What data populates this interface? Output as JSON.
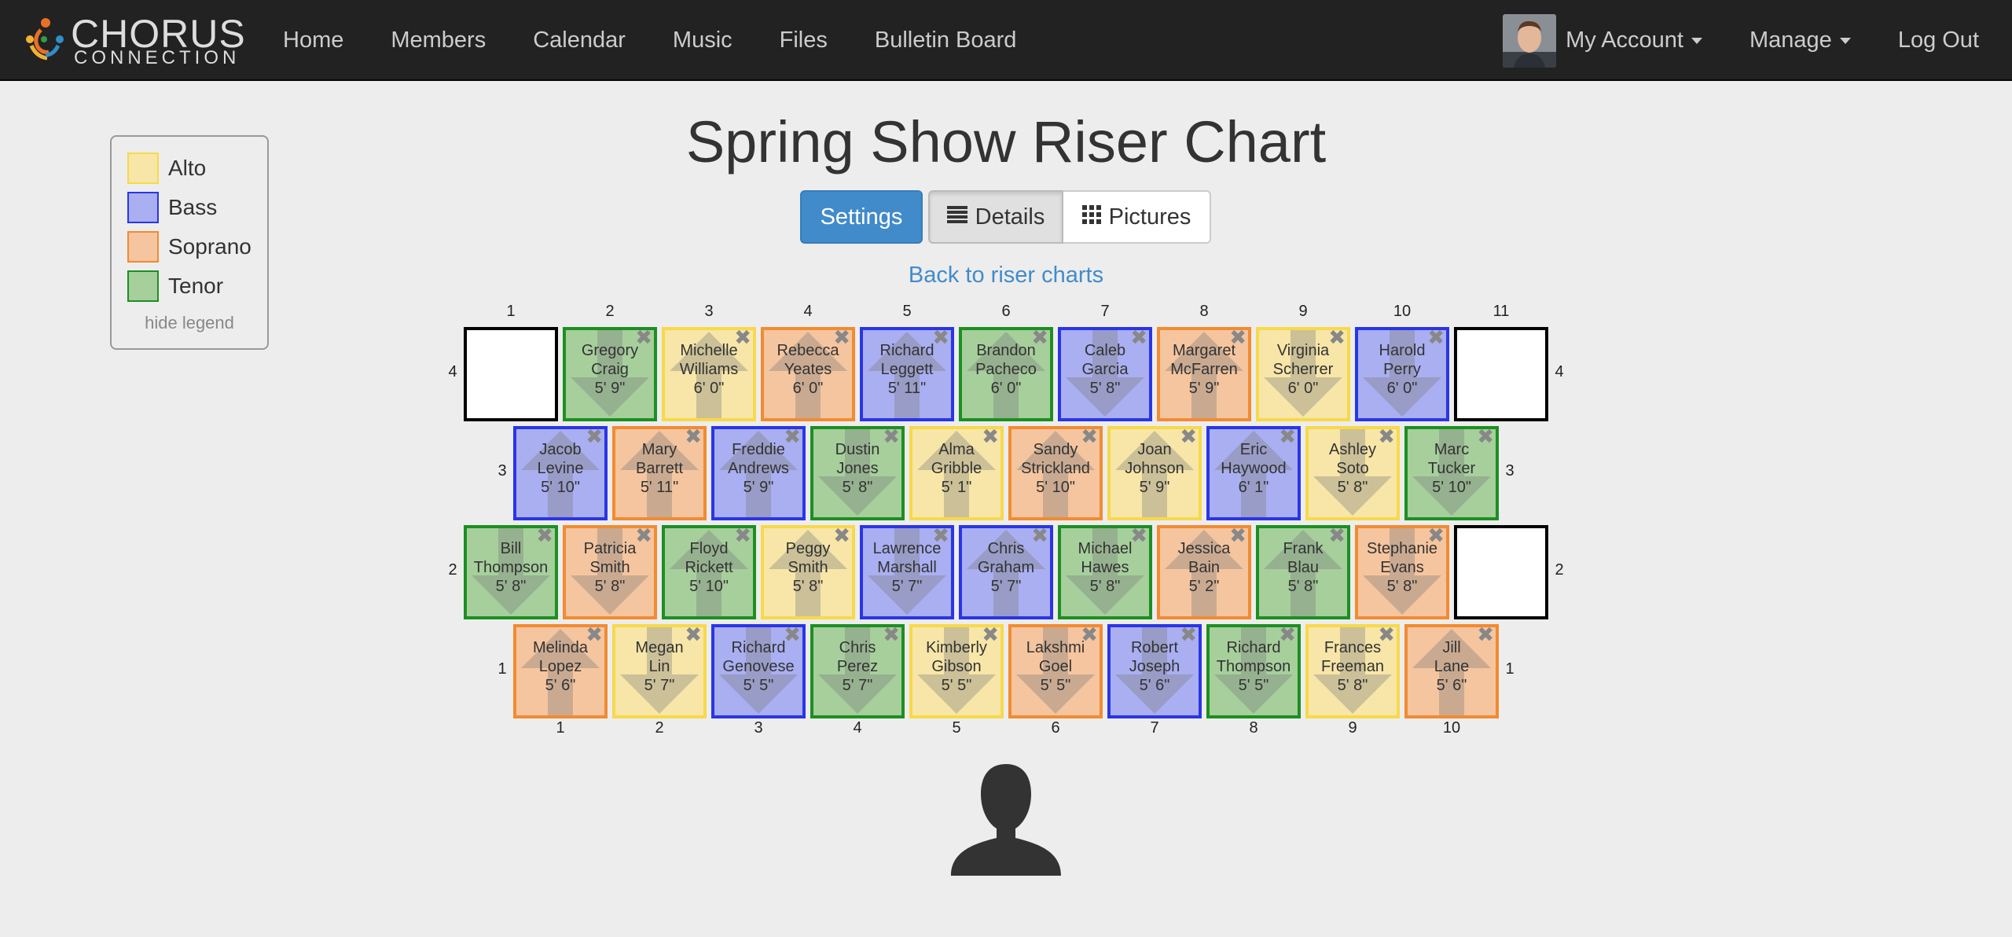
{
  "nav": {
    "brand_top": "CHORUS",
    "brand_bottom": "CONNECTION",
    "links": [
      "Home",
      "Members",
      "Calendar",
      "Music",
      "Files",
      "Bulletin Board"
    ],
    "account": "My Account",
    "manage": "Manage",
    "logout": "Log Out"
  },
  "legend": {
    "items": [
      {
        "label": "Alto",
        "color": "#f7e6a8",
        "border": "#f7d94a"
      },
      {
        "label": "Bass",
        "color": "#a9aff0",
        "border": "#2a35e6"
      },
      {
        "label": "Soprano",
        "color": "#f5c59f",
        "border": "#f28b31"
      },
      {
        "label": "Tenor",
        "color": "#a6cf9c",
        "border": "#1d8f22"
      }
    ],
    "hide": "hide legend"
  },
  "title": "Spring Show Riser Chart",
  "buttons": {
    "settings": "Settings",
    "details": "Details",
    "pictures": "Pictures"
  },
  "back_link": "Back to riser charts",
  "riser": {
    "top_positions": [
      "1",
      "2",
      "3",
      "4",
      "5",
      "6",
      "7",
      "8",
      "9",
      "10",
      "11"
    ],
    "bottom_positions": [
      "1",
      "2",
      "3",
      "4",
      "5",
      "6",
      "7",
      "8",
      "9",
      "10"
    ],
    "rows": [
      {
        "row": "4",
        "wide": true,
        "cells": [
          {
            "part": "empty"
          },
          {
            "part": "tenor",
            "first": "Gregory",
            "last": "Craig",
            "height": "5' 9\"",
            "dir": "down"
          },
          {
            "part": "alto",
            "first": "Michelle",
            "last": "Williams",
            "height": "6' 0\"",
            "dir": "up"
          },
          {
            "part": "soprano",
            "first": "Rebecca",
            "last": "Yeates",
            "height": "6' 0\"",
            "dir": "up"
          },
          {
            "part": "bass",
            "first": "Richard",
            "last": "Leggett",
            "height": "5' 11\"",
            "dir": "up"
          },
          {
            "part": "tenor",
            "first": "Brandon",
            "last": "Pacheco",
            "height": "6' 0\"",
            "dir": "up"
          },
          {
            "part": "bass",
            "first": "Caleb",
            "last": "Garcia",
            "height": "5' 8\"",
            "dir": "down"
          },
          {
            "part": "soprano",
            "first": "Margaret",
            "last": "McFarren",
            "height": "5' 9\"",
            "dir": "up"
          },
          {
            "part": "alto",
            "first": "Virginia",
            "last": "Scherrer",
            "height": "6' 0\"",
            "dir": "down"
          },
          {
            "part": "bass",
            "first": "Harold",
            "last": "Perry",
            "height": "6' 0\"",
            "dir": "down"
          },
          {
            "part": "empty"
          }
        ]
      },
      {
        "row": "3",
        "wide": false,
        "cells": [
          {
            "part": "bass",
            "first": "Jacob",
            "last": "Levine",
            "height": "5' 10\"",
            "dir": "up"
          },
          {
            "part": "soprano",
            "first": "Mary",
            "last": "Barrett",
            "height": "5' 11\"",
            "dir": "up"
          },
          {
            "part": "bass",
            "first": "Freddie",
            "last": "Andrews",
            "height": "5' 9\"",
            "dir": "up"
          },
          {
            "part": "tenor",
            "first": "Dustin",
            "last": "Jones",
            "height": "5' 8\"",
            "dir": "down"
          },
          {
            "part": "alto",
            "first": "Alma",
            "last": "Gribble",
            "height": "5' 1\"",
            "dir": "up"
          },
          {
            "part": "soprano",
            "first": "Sandy",
            "last": "Strickland",
            "height": "5' 10\"",
            "dir": "up"
          },
          {
            "part": "alto",
            "first": "Joan",
            "last": "Johnson",
            "height": "5' 9\"",
            "dir": "up"
          },
          {
            "part": "bass",
            "first": "Eric",
            "last": "Haywood",
            "height": "6' 1\"",
            "dir": "up"
          },
          {
            "part": "alto",
            "first": "Ashley",
            "last": "Soto",
            "height": "5' 8\"",
            "dir": "down"
          },
          {
            "part": "tenor",
            "first": "Marc",
            "last": "Tucker",
            "height": "5' 10\"",
            "dir": "down"
          }
        ]
      },
      {
        "row": "2",
        "wide": true,
        "cells": [
          {
            "part": "tenor",
            "first": "Bill",
            "last": "Thompson",
            "height": "5' 8\"",
            "dir": "down"
          },
          {
            "part": "soprano",
            "first": "Patricia",
            "last": "Smith",
            "height": "5' 8\"",
            "dir": "down"
          },
          {
            "part": "tenor",
            "first": "Floyd",
            "last": "Rickett",
            "height": "5' 10\"",
            "dir": "up"
          },
          {
            "part": "alto",
            "first": "Peggy",
            "last": "Smith",
            "height": "5' 8\"",
            "dir": "up"
          },
          {
            "part": "bass",
            "first": "Lawrence",
            "last": "Marshall",
            "height": "5' 7\"",
            "dir": "down"
          },
          {
            "part": "bass",
            "first": "Chris",
            "last": "Graham",
            "height": "5' 7\"",
            "dir": "up"
          },
          {
            "part": "tenor",
            "first": "Michael",
            "last": "Hawes",
            "height": "5' 8\"",
            "dir": "down"
          },
          {
            "part": "soprano",
            "first": "Jessica",
            "last": "Bain",
            "height": "5' 2\"",
            "dir": "up"
          },
          {
            "part": "tenor",
            "first": "Frank",
            "last": "Blau",
            "height": "5' 8\"",
            "dir": "up"
          },
          {
            "part": "soprano",
            "first": "Stephanie",
            "last": "Evans",
            "height": "5' 8\"",
            "dir": "down"
          },
          {
            "part": "empty"
          }
        ]
      },
      {
        "row": "1",
        "wide": false,
        "cells": [
          {
            "part": "soprano",
            "first": "Melinda",
            "last": "Lopez",
            "height": "5' 6\"",
            "dir": "up"
          },
          {
            "part": "alto",
            "first": "Megan",
            "last": "Lin",
            "height": "5' 7\"",
            "dir": "down"
          },
          {
            "part": "bass",
            "first": "Richard",
            "last": "Genovese",
            "height": "5' 5\"",
            "dir": "down"
          },
          {
            "part": "tenor",
            "first": "Chris",
            "last": "Perez",
            "height": "5' 7\"",
            "dir": "down"
          },
          {
            "part": "alto",
            "first": "Kimberly",
            "last": "Gibson",
            "height": "5' 5\"",
            "dir": "down"
          },
          {
            "part": "soprano",
            "first": "Lakshmi",
            "last": "Goel",
            "height": "5' 5\"",
            "dir": "down"
          },
          {
            "part": "bass",
            "first": "Robert",
            "last": "Joseph",
            "height": "5' 6\"",
            "dir": "down"
          },
          {
            "part": "tenor",
            "first": "Richard",
            "last": "Thompson",
            "height": "5' 5\"",
            "dir": "down"
          },
          {
            "part": "alto",
            "first": "Frances",
            "last": "Freeman",
            "height": "5' 8\"",
            "dir": "down"
          },
          {
            "part": "soprano",
            "first": "Jill",
            "last": "Lane",
            "height": "5' 6\"",
            "dir": "up"
          }
        ]
      }
    ],
    "remove_glyph": "✖"
  },
  "icons": {
    "logo": "chorus-connection-logo",
    "avatar": "user-avatar",
    "details": "list-icon",
    "pictures": "grid-icon",
    "director": "person-silhouette-icon"
  }
}
